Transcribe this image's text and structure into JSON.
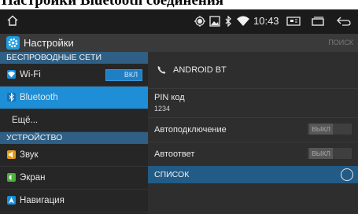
{
  "caption": {
    "text": "Настройки Bluetooth соединения"
  },
  "status_bar": {
    "time": "10:43",
    "icons": [
      "home-icon",
      "location-icon",
      "gallery-icon",
      "bluetooth-icon",
      "wifi-icon",
      "screenshot-icon",
      "recent-apps-icon",
      "back-icon"
    ]
  },
  "title_bar": {
    "title": "Настройки",
    "search": "ПОИСК"
  },
  "sidebar": {
    "sections": [
      "БЕСПРОВОДНЫЕ СЕТИ",
      "УСТРОЙСТВО"
    ],
    "items": [
      {
        "label": "Wi-Fi",
        "toggle": "ВКЛ"
      },
      {
        "label": "Bluetooth"
      },
      {
        "label": "Ещё..."
      },
      {
        "label": "Звук"
      },
      {
        "label": "Экран"
      },
      {
        "label": "Навигация"
      }
    ]
  },
  "main": {
    "device_name": "ANDROID BT",
    "pin_label": "PIN код",
    "pin_value": "1234",
    "auto_connect": {
      "label": "Автоподключение",
      "state": "ВЫКЛ"
    },
    "auto_answer": {
      "label": "Автоответ",
      "state": "ВЫКЛ"
    },
    "list_label": "СПИСОК"
  },
  "colors": {
    "accent": "#1e8ed6",
    "section_header": "#2f5f84",
    "list_header": "#215b86",
    "background": "#2a2a2a"
  }
}
